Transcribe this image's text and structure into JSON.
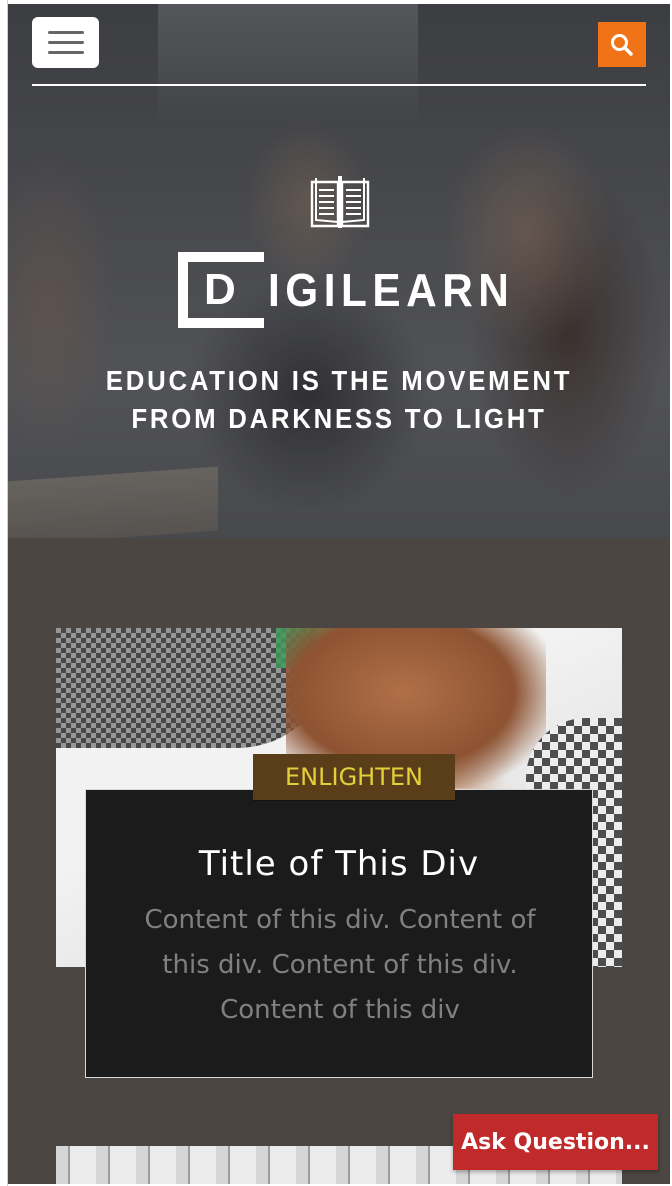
{
  "header": {
    "menu_icon": "hamburger-icon",
    "search_icon": "search-icon",
    "search_color": "#f07317"
  },
  "hero": {
    "logo_letter": "D",
    "logo_rest": "IGILEARN",
    "book_icon": "open-book-icon",
    "tagline_line1": "EDUCATION IS THE MOVEMENT",
    "tagline_line2": "FROM DARKNESS TO LIGHT"
  },
  "card": {
    "badge": "ENLIGHTEN",
    "title": "Title of This Div",
    "content": "Content of this div. Content of this div. Content of this div. Content of this div"
  },
  "ask_button": {
    "label": "Ask Question...",
    "color": "#c02a2a"
  }
}
